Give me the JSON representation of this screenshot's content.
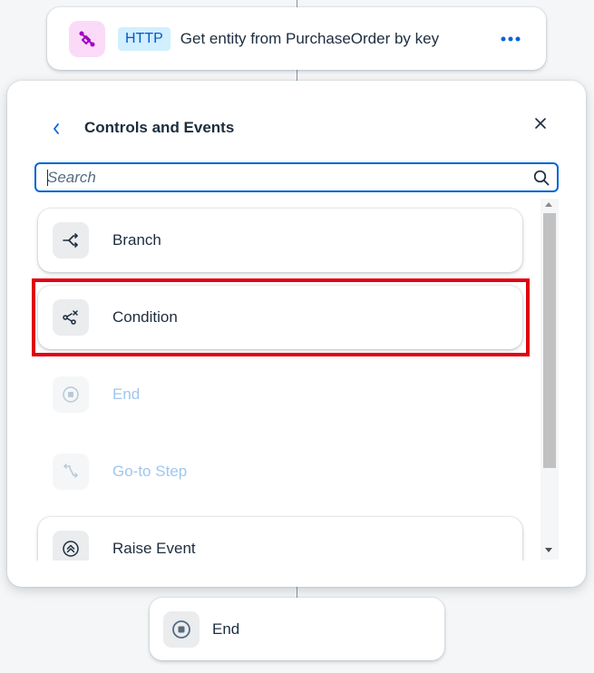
{
  "top_step": {
    "badge": "HTTP",
    "title": "Get entity from PurchaseOrder by key",
    "icon": "link-icon",
    "more_icon": "more-icon"
  },
  "popover": {
    "title": "Controls and Events",
    "back_icon": "chevron-left-icon",
    "close_icon": "close-icon",
    "search": {
      "placeholder": "Search",
      "value": "",
      "icon": "search-icon"
    },
    "items": [
      {
        "label": "Branch",
        "icon": "branch-icon",
        "enabled": true
      },
      {
        "label": "Condition",
        "icon": "condition-icon",
        "enabled": true,
        "highlighted": true
      },
      {
        "label": "End",
        "icon": "stop-icon",
        "enabled": false
      },
      {
        "label": "Go-to Step",
        "icon": "goto-icon",
        "enabled": false
      },
      {
        "label": "Raise Event",
        "icon": "raise-event-icon",
        "enabled": true
      }
    ]
  },
  "end_step": {
    "label": "End",
    "icon": "stop-icon"
  },
  "colors": {
    "accent": "#0064d9",
    "highlight": "#e0000f",
    "disabled_text": "#9fc6ee",
    "http_badge_bg": "#d1efff",
    "http_icon_bg": "#fbdaf7"
  }
}
